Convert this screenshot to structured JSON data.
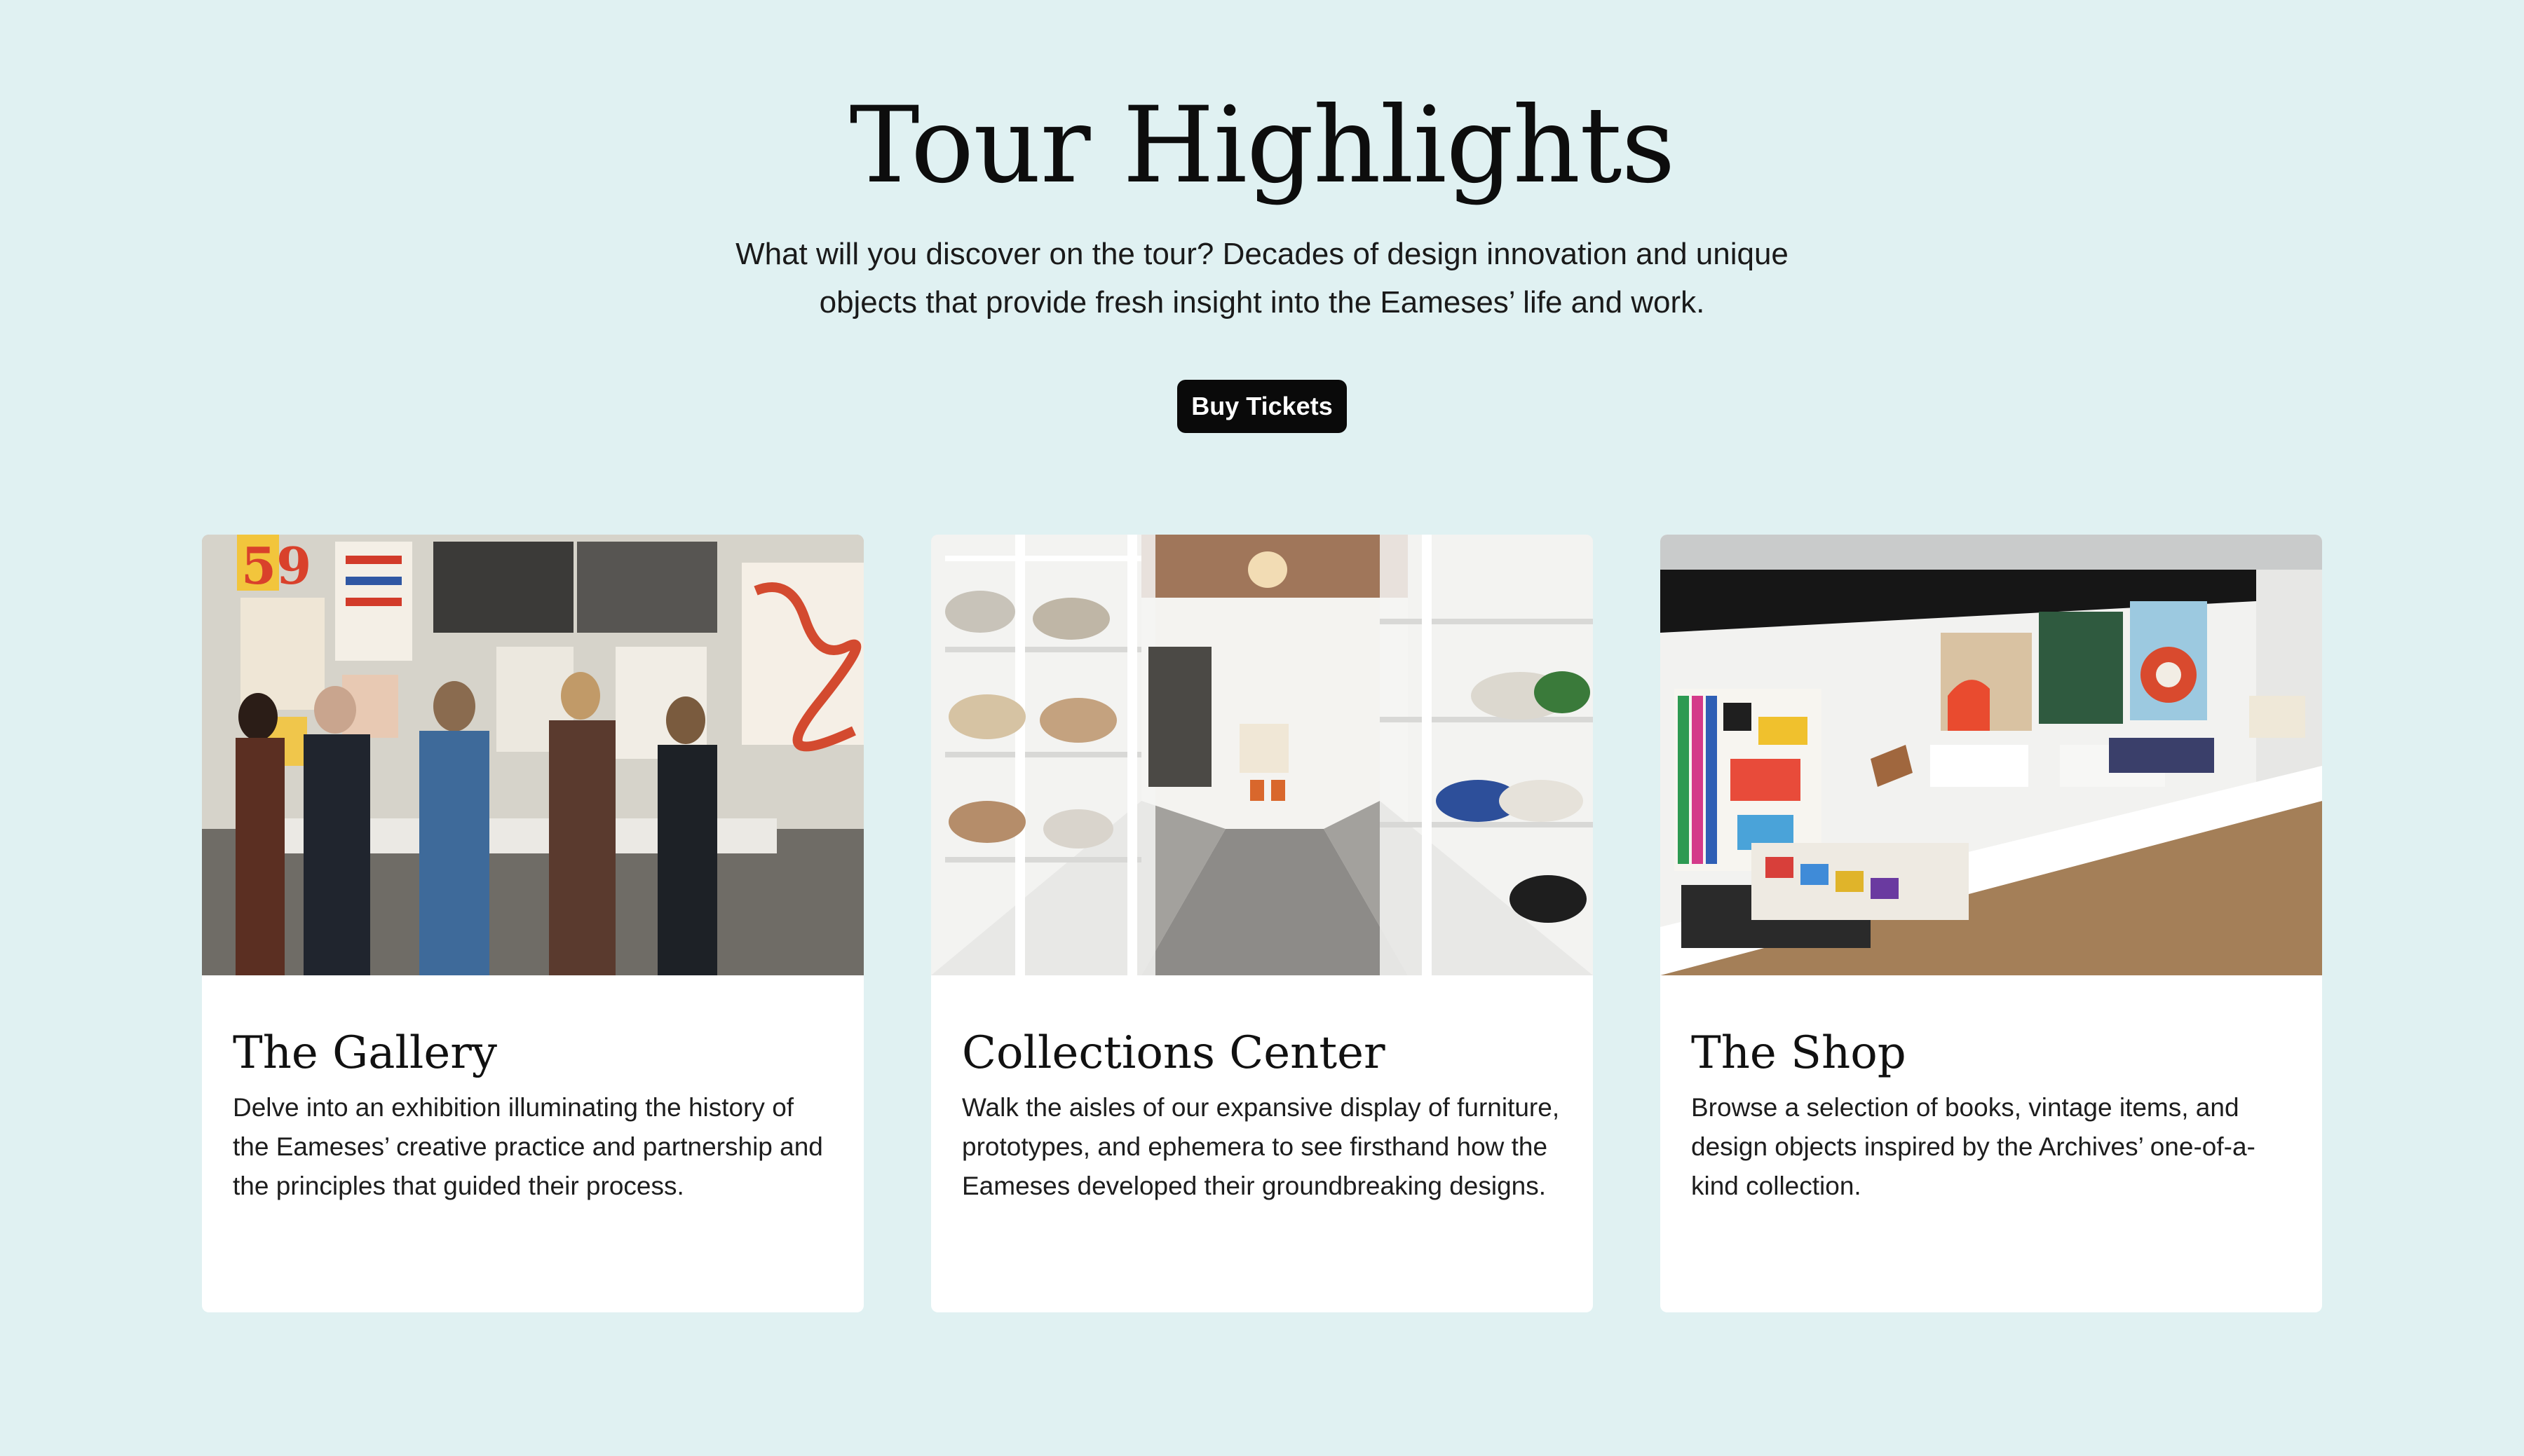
{
  "page": {
    "background_color": "#e0f1f2",
    "accent_color": "#0a0a0a"
  },
  "section": {
    "title": "Tour Highlights",
    "intro": "What will you discover on the tour? Decades of design innovation and unique objects that provide fresh insight into the Eameses’ life and work.",
    "buy_button_label": "Buy Tickets"
  },
  "cards": [
    {
      "title": "The Gallery",
      "description": "Delve into an exhibition illuminating the history of the Eameses’ creative practice and partnership and the principles that guided their process.",
      "image_icon": "gallery-photo-icon"
    },
    {
      "title": "Collections Center",
      "description": "Walk the aisles of our expansive display of furniture, prototypes, and ephemera to see firsthand how the Eameses developed their groundbreaking designs.",
      "image_icon": "collections-photo-icon"
    },
    {
      "title": "The Shop",
      "description": "Browse a selection of books, vintage items, and design objects inspired by the Archives’ one-of-a-kind collection.",
      "image_icon": "shop-photo-icon"
    }
  ]
}
